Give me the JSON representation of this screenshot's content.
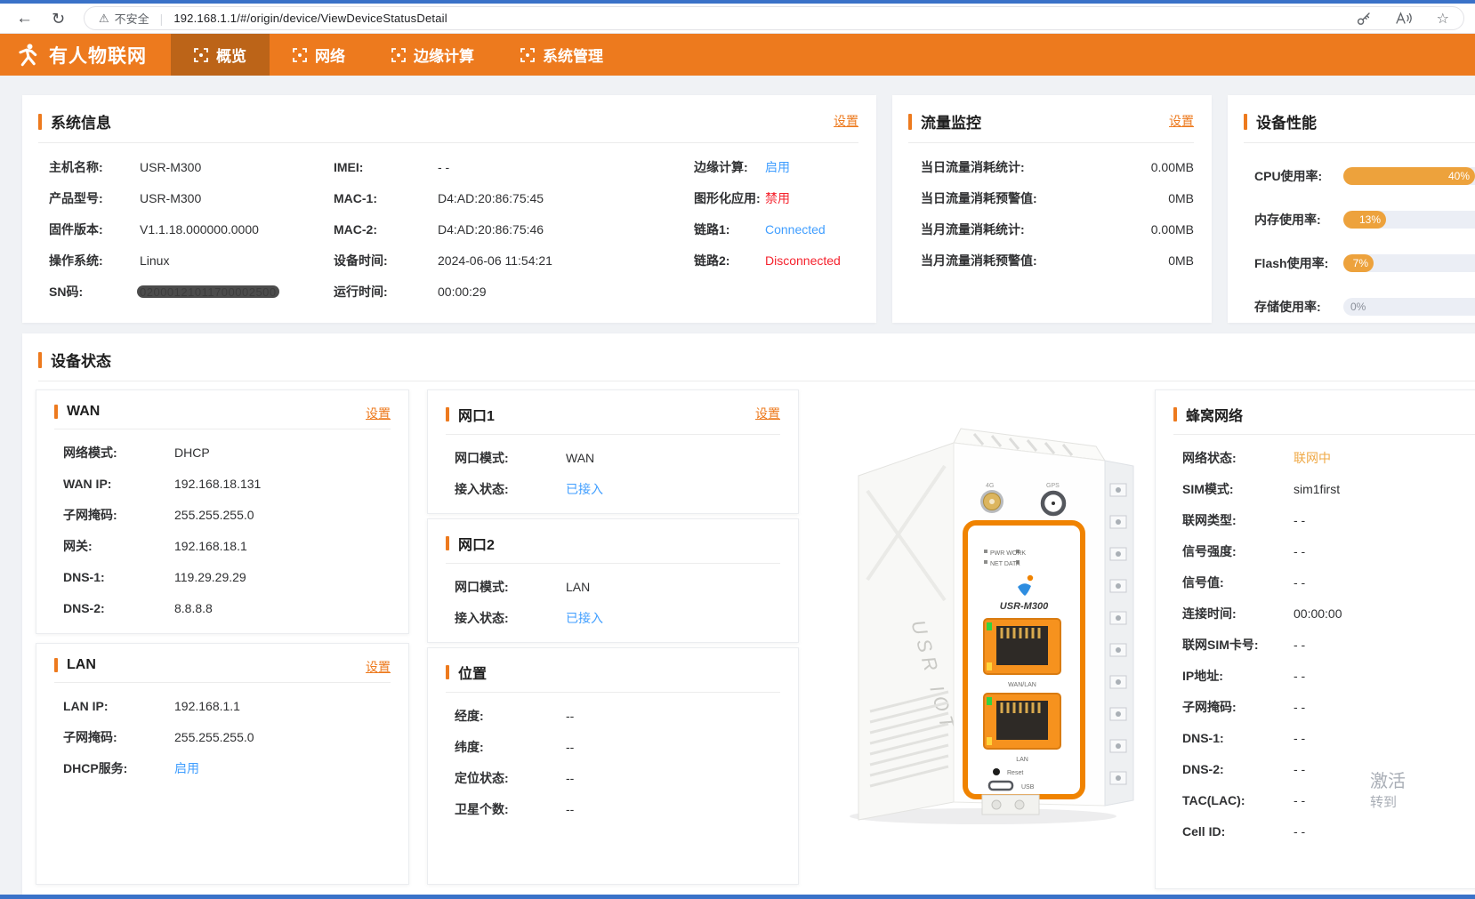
{
  "colors": {
    "accent_orange": "#ed7a1e",
    "navbar_orange": "#ed7a1e",
    "active_tab_orange": "#bc6418",
    "link_blue": "#409eff",
    "status_red": "#f5222d",
    "status_orange": "#efa844",
    "fill_orange": "#eda23c",
    "page_bg": "#f0f2f5",
    "window_blue": "#3a72c8"
  },
  "browser": {
    "back_icon": "←",
    "reload_icon": "↻",
    "warning_icon": "⚠",
    "security_label": "不安全",
    "url": "192.168.1.1/#/origin/device/ViewDeviceStatusDetail",
    "favorite_icon": "☆"
  },
  "navbar": {
    "brand": "有人物联网",
    "tabs": [
      {
        "label": "概览",
        "active": true
      },
      {
        "label": "网络",
        "active": false
      },
      {
        "label": "边缘计算",
        "active": false
      },
      {
        "label": "系统管理",
        "active": false
      }
    ]
  },
  "system_info": {
    "title": "系统信息",
    "settings": "设置",
    "col1": [
      {
        "label": "主机名称:",
        "value": "USR-M300"
      },
      {
        "label": "产品型号:",
        "value": "USR-M300"
      },
      {
        "label": "固件版本:",
        "value": "V1.1.18.000000.0000"
      },
      {
        "label": "操作系统:",
        "value": "Linux"
      },
      {
        "label": "SN码:",
        "value": "02000121011700002500",
        "redacted": true
      }
    ],
    "col2": [
      {
        "label": "IMEI:",
        "value": "- -"
      },
      {
        "label": "MAC-1:",
        "value": "D4:AD:20:86:75:45"
      },
      {
        "label": "MAC-2:",
        "value": "D4:AD:20:86:75:46"
      },
      {
        "label": "设备时间:",
        "value": "2024-06-06 11:54:21"
      },
      {
        "label": "运行时间:",
        "value": "00:00:29"
      }
    ],
    "col3": [
      {
        "label": "边缘计算:",
        "value": "启用"
      },
      {
        "label": "图形化应用:",
        "value": "禁用"
      },
      {
        "label": "链路1:",
        "value": "Connected"
      },
      {
        "label": "链路2:",
        "value": "Disconnected"
      }
    ]
  },
  "traffic": {
    "title": "流量监控",
    "settings": "设置",
    "rows": [
      {
        "label": "当日流量消耗统计:",
        "value": "0.00MB"
      },
      {
        "label": "当日流量消耗预警值:",
        "value": "0MB"
      },
      {
        "label": "当月流量消耗统计:",
        "value": "0.00MB"
      },
      {
        "label": "当月流量消耗预警值:",
        "value": "0MB"
      }
    ]
  },
  "performance": {
    "title": "设备性能",
    "rows": [
      {
        "label": "CPU使用率:",
        "value": "40%",
        "fill": 148
      },
      {
        "label": "内存使用率:",
        "value": "13%",
        "fill": 48
      },
      {
        "label": "Flash使用率:",
        "value": "7%",
        "fill": 34
      },
      {
        "label": "存储使用率:",
        "value": "0%",
        "fill": 0
      }
    ]
  },
  "device_status": {
    "title": "设备状态",
    "wan": {
      "title": "WAN",
      "settings": "设置",
      "rows": [
        {
          "label": "网络模式:",
          "value": "DHCP"
        },
        {
          "label": "WAN IP:",
          "value": "192.168.18.131"
        },
        {
          "label": "子网掩码:",
          "value": "255.255.255.0"
        },
        {
          "label": "网关:",
          "value": "192.168.18.1"
        },
        {
          "label": "DNS-1:",
          "value": "119.29.29.29"
        },
        {
          "label": "DNS-2:",
          "value": "8.8.8.8"
        }
      ]
    },
    "lan": {
      "title": "LAN",
      "settings": "设置",
      "rows": [
        {
          "label": "LAN IP:",
          "value": "192.168.1.1"
        },
        {
          "label": "子网掩码:",
          "value": "255.255.255.0"
        },
        {
          "label": "DHCP服务:",
          "value": "启用"
        }
      ]
    },
    "eth1": {
      "title": "网口1",
      "settings": "设置",
      "rows": [
        {
          "label": "网口模式:",
          "value": "WAN"
        },
        {
          "label": "接入状态:",
          "value": "已接入"
        }
      ]
    },
    "eth2": {
      "title": "网口2",
      "rows": [
        {
          "label": "网口模式:",
          "value": "LAN"
        },
        {
          "label": "接入状态:",
          "value": "已接入"
        }
      ]
    },
    "location": {
      "title": "位置",
      "rows": [
        {
          "label": "经度:",
          "value": "--"
        },
        {
          "label": "纬度:",
          "value": "--"
        },
        {
          "label": "定位状态:",
          "value": "--"
        },
        {
          "label": "卫星个数:",
          "value": "--"
        }
      ]
    },
    "cellular": {
      "title": "蜂窝网络",
      "rows": [
        {
          "label": "网络状态:",
          "value": "联网中"
        },
        {
          "label": "SIM模式:",
          "value": "sim1first"
        },
        {
          "label": "联网类型:",
          "value": "- -"
        },
        {
          "label": "信号强度:",
          "value": "- -"
        },
        {
          "label": "信号值:",
          "value": "- -"
        },
        {
          "label": "连接时间:",
          "value": "00:00:00"
        },
        {
          "label": "联网SIM卡号:",
          "value": "- -"
        },
        {
          "label": "IP地址:",
          "value": "- -"
        },
        {
          "label": "子网掩码:",
          "value": "- -"
        },
        {
          "label": "DNS-1:",
          "value": "- -"
        },
        {
          "label": "DNS-2:",
          "value": "- -"
        },
        {
          "label": "TAC(LAC):",
          "value": "- -"
        },
        {
          "label": "Cell ID:",
          "value": "- -"
        }
      ]
    }
  },
  "device_image": {
    "side_text": "USR IOT",
    "model": "USR-M300",
    "led_row1": "PWR  WORK",
    "led_row2": "NET  DATA",
    "ant1_label": "4G",
    "ant2_label": "GPS",
    "port1_label": "WAN/LAN",
    "port2_label": "LAN",
    "reset_label": "Reset",
    "usb_label": "USB"
  },
  "watermark": {
    "line1": "激活",
    "line2": "转到"
  }
}
